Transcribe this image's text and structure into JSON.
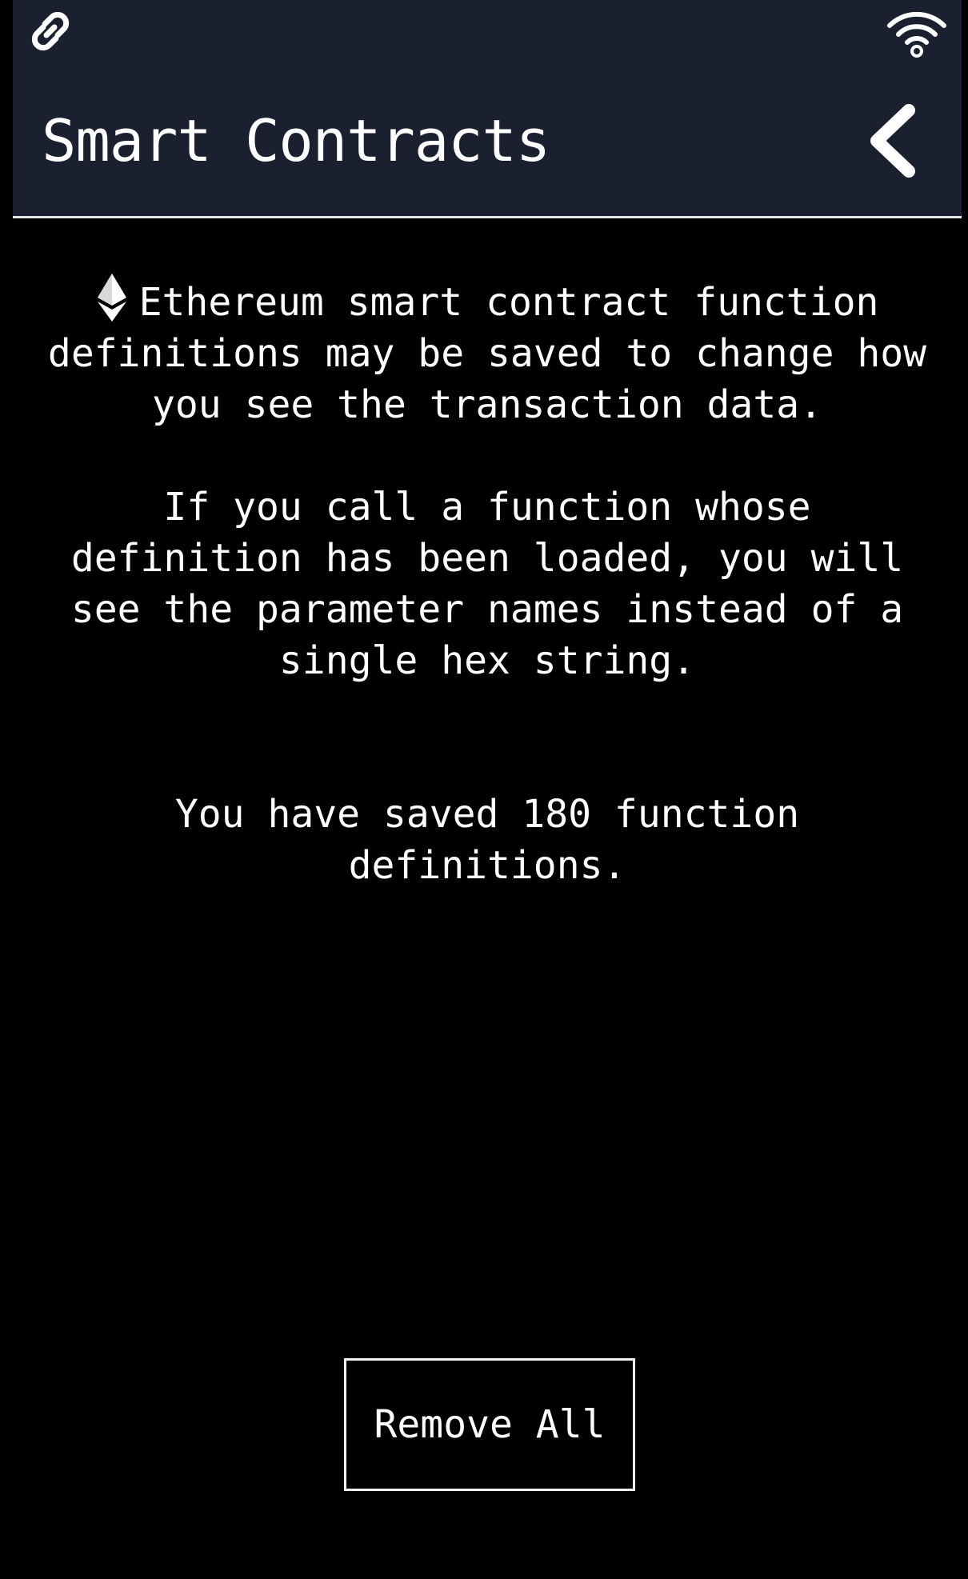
{
  "status_bar": {
    "left_icon": "link-icon",
    "right_icon": "wifi-icon"
  },
  "header": {
    "title": "Smart Contracts",
    "back_icon": "chevron-left-icon"
  },
  "content": {
    "coin_icon": "ethereum-icon",
    "intro": "Ethereum smart contract function definitions may be saved to change how you see the transaction data.",
    "explanation": "If you call a function whose definition has been loaded, you will see the parameter names instead of a single hex string.",
    "saved_count": "You have saved 180 function definitions."
  },
  "actions": {
    "remove_all_label": "Remove All"
  },
  "colors": {
    "header_background": "#1b2030",
    "screen_background": "#000000",
    "text": "#ffffff",
    "divider": "#e8e8e8"
  }
}
